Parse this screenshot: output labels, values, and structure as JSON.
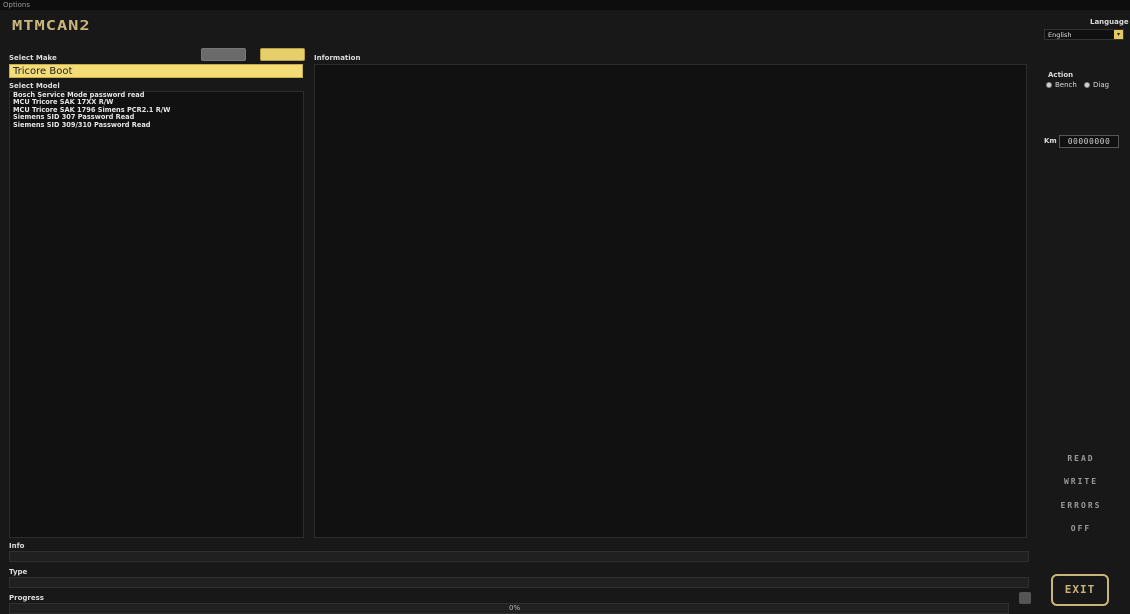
{
  "window": {
    "title": "Options"
  },
  "app": {
    "logo": "MTMCAN2"
  },
  "left": {
    "select_make_label": "Select Make",
    "make_value": "Tricore Boot",
    "select_model_label": "Select Model",
    "models": [
      "Bosch Service Mode password read",
      "MCU Tricore SAK 17XX R/W",
      "MCU Tricore SAK 1796 Simens PCR2.1 R/W",
      "Siemens SID 307 Password Read",
      "Siemens SID 309/310 Password Read"
    ]
  },
  "information": {
    "label": "Information"
  },
  "right": {
    "language_label": "Language",
    "language_value": "English",
    "action_label": "Action",
    "action_options": [
      "Bench",
      "Diag"
    ],
    "km_label": "Km",
    "km_value": "00000000",
    "buttons": [
      "READ",
      "WRITE",
      "ERRORS",
      "OFF"
    ],
    "exit_label": "EXIT"
  },
  "bottom": {
    "info_label": "Info",
    "type_label": "Type",
    "progress_label": "Progress",
    "progress_value": "0%"
  },
  "colors": {
    "accent": "#f4dd77",
    "background": "#181818"
  }
}
